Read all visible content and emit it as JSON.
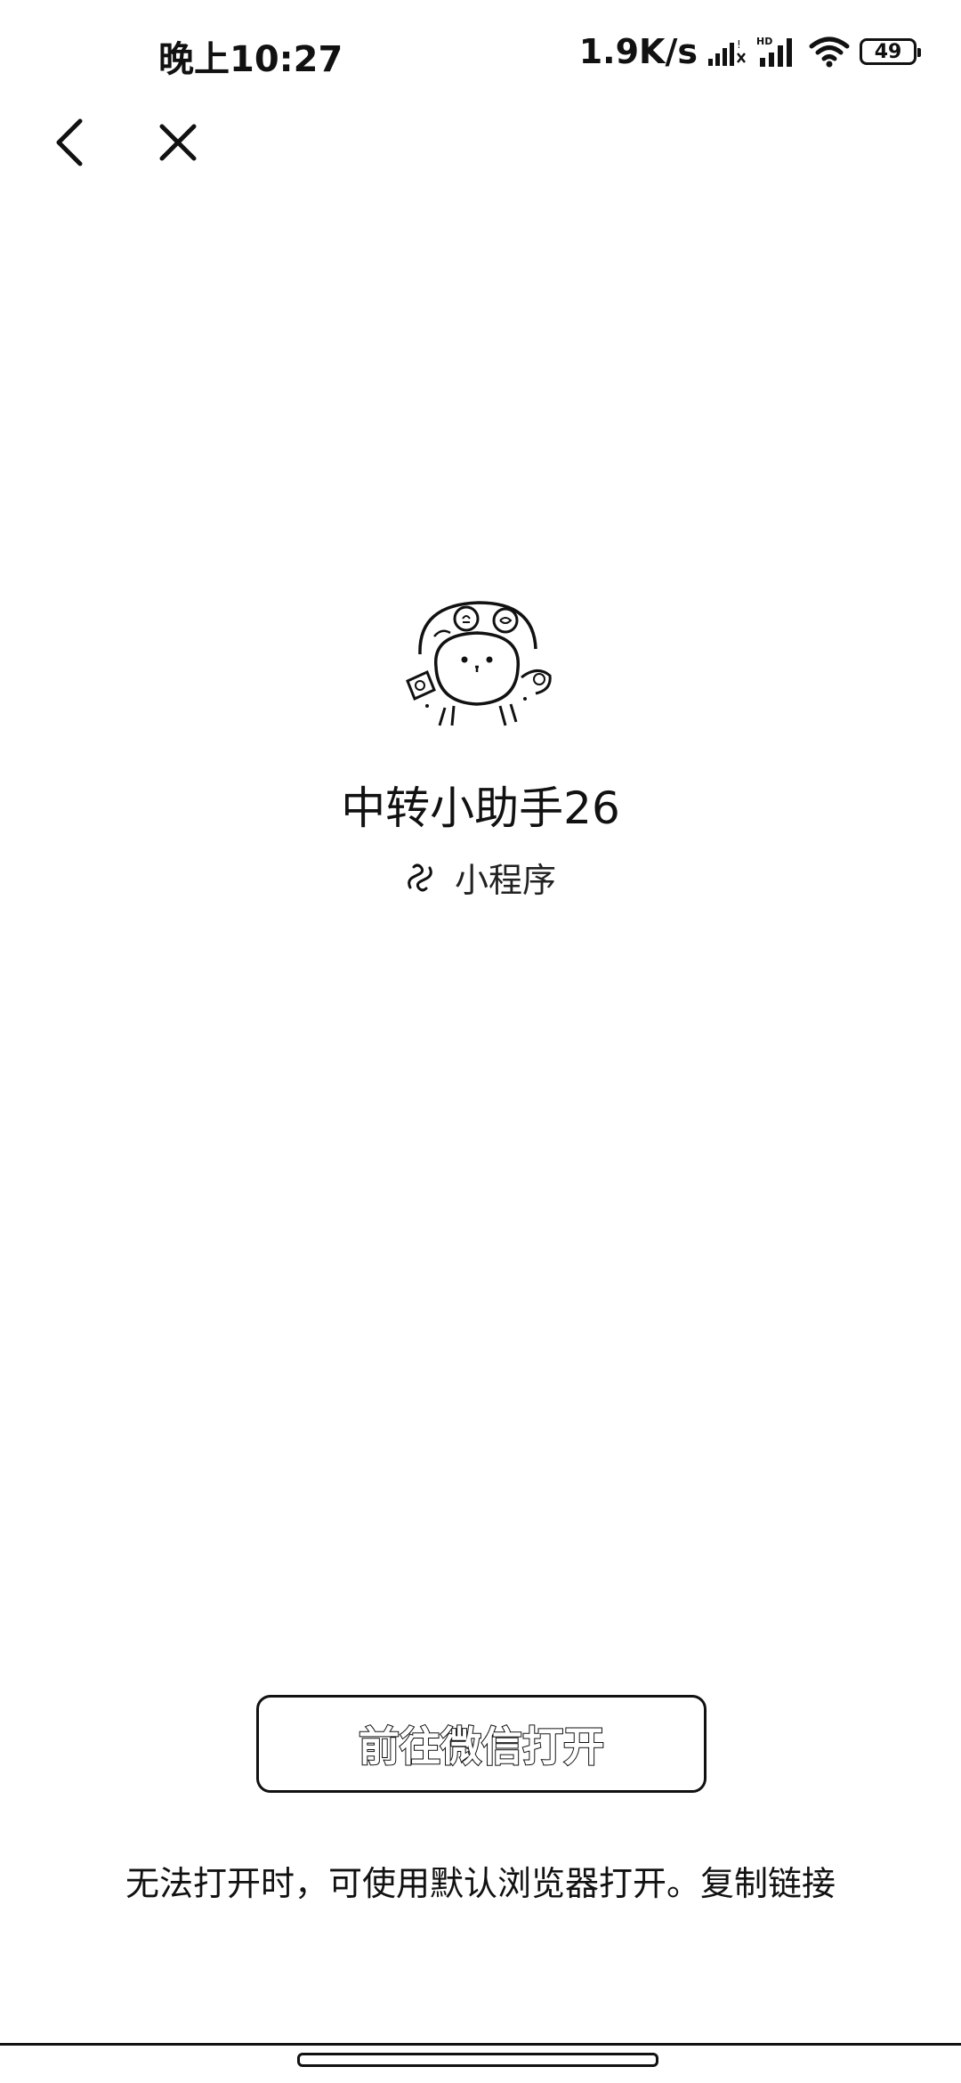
{
  "status_bar": {
    "time": "晚上10:27",
    "network_speed": "1.9K/s",
    "battery_level": "49",
    "icons": [
      "signal-icon",
      "hd-signal-icon",
      "wifi-icon",
      "battery-icon"
    ]
  },
  "nav": {
    "back_icon": "back-arrow-icon",
    "close_icon": "close-icon"
  },
  "mini_program": {
    "name": "中转小助手26",
    "type_label": "小程序",
    "type_icon": "mini-program-icon",
    "avatar_icon": "cartoon-avatar-icon"
  },
  "actions": {
    "open_in_wechat_label": "前往微信打开",
    "hint_text": "无法打开时，可使用默认浏览器打开。",
    "copy_link_label": "复制链接"
  }
}
